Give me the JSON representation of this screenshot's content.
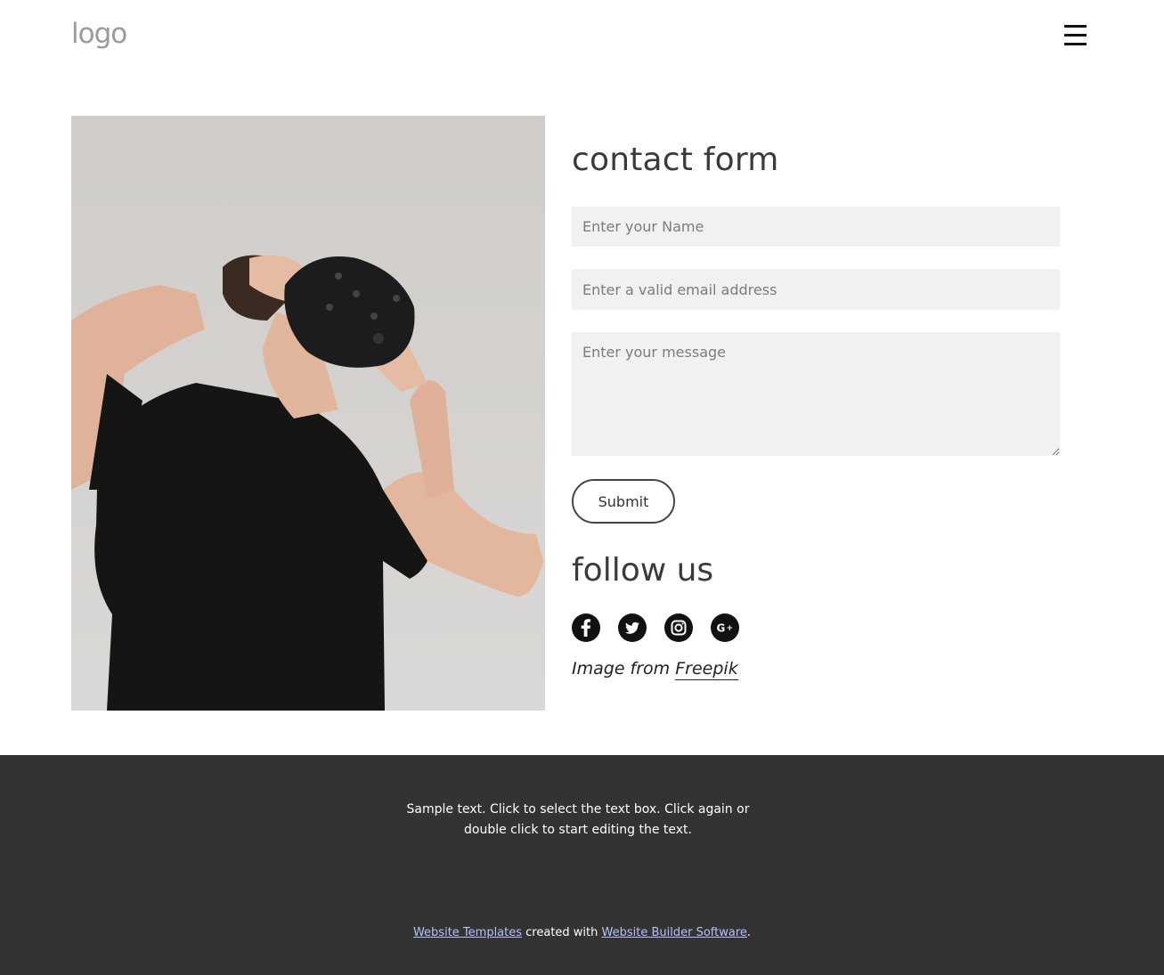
{
  "header": {
    "logo_text": "logo",
    "menu_icon": "hamburger-menu-icon"
  },
  "hero_image": {
    "description_icon": "person-vr-headset-photo"
  },
  "contact": {
    "title": "contact form",
    "name_placeholder": "Enter your Name",
    "email_placeholder": "Enter a valid email address",
    "message_placeholder": "Enter your message",
    "submit_label": "Submit"
  },
  "follow": {
    "title": "follow us",
    "icons": [
      "facebook-icon",
      "twitter-icon",
      "instagram-icon",
      "google-plus-icon"
    ]
  },
  "credit": {
    "prefix": "Image from",
    "link": "Freepik"
  },
  "footer": {
    "sample_text": "Sample text. Click to select the text box. Click again or double click to start editing the text.",
    "link1": "Website Templates",
    "middle": " created with ",
    "link2": "Website Builder Software",
    "suffix": "."
  },
  "colors": {
    "footer_bg": "#333333",
    "input_bg": "#f1f1f1",
    "footer_link": "#b3c2ff"
  }
}
